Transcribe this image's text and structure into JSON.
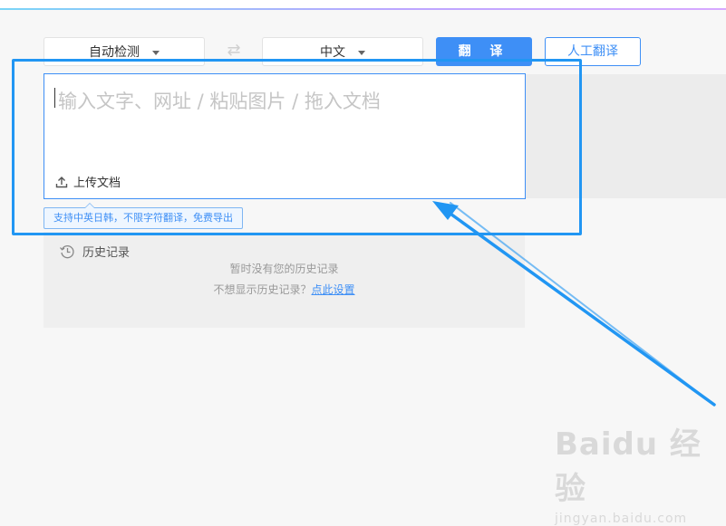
{
  "toolbar": {
    "source_language": "自动检测",
    "target_language": "中文",
    "swap_symbol": "⇄",
    "translate_button": "翻 译",
    "human_translation_button": "人工翻译"
  },
  "editor": {
    "placeholder": "输入文字、网址 / 粘贴图片 / 拖入文档",
    "upload_label": "上传文档",
    "tip": "支持中英日韩，不限字符翻译，免费导出"
  },
  "history": {
    "title": "历史记录",
    "empty_message": "暂时没有您的历史记录",
    "hide_prompt": "不想显示历史记录？",
    "settings_link": "点此设置"
  },
  "watermark": {
    "brand": "Baidu 经验",
    "site": "jingyan.baidu.com"
  },
  "colors": {
    "accent": "#3e8ff6",
    "annotation": "#2196f3",
    "background": "#f7f7f7"
  }
}
